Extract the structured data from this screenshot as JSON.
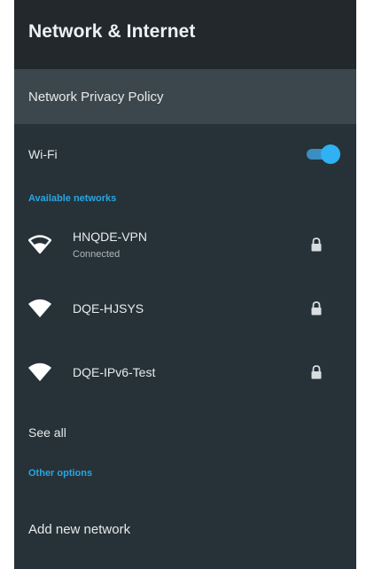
{
  "header": {
    "title": "Network & Internet"
  },
  "privacy_policy": {
    "label": "Network Privacy Policy"
  },
  "wifi": {
    "label": "Wi-Fi",
    "enabled": true
  },
  "sections": {
    "available": "Available networks",
    "other": "Other options"
  },
  "networks": [
    {
      "name": "HNQDE-VPN",
      "status": "Connected",
      "icon": "wifi-outline-icon",
      "secured": true
    },
    {
      "name": "DQE-HJSYS",
      "status": "",
      "icon": "wifi-full-icon",
      "secured": true
    },
    {
      "name": "DQE-IPv6-Test",
      "status": "",
      "icon": "wifi-full-icon",
      "secured": true
    }
  ],
  "see_all": "See all",
  "add_network": "Add new network",
  "colors": {
    "panel": "#263238",
    "header": "#22282c",
    "highlight": "#3c474d",
    "accent": "#27a7e2",
    "toggle_thumb": "#2fb1f3"
  }
}
